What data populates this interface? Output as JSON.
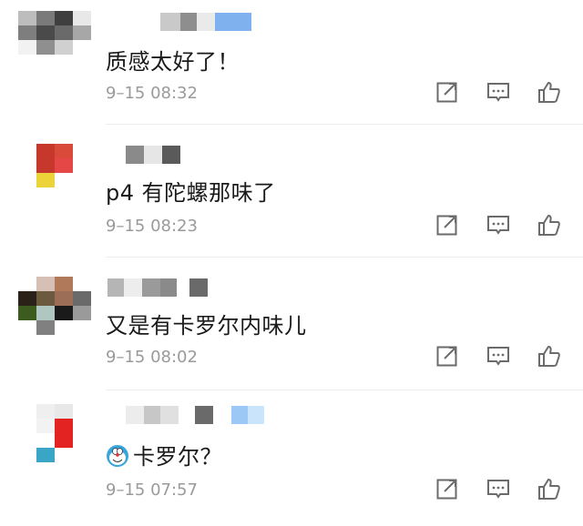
{
  "comments": [
    {
      "text": "质感太好了！",
      "time": "9–15 08:32",
      "avatar": [
        "#bdbdbd",
        "#7a7a7a",
        "#3f3f3f",
        "#e8e8e8",
        "#7e7e7e",
        "#4a4a4a",
        "#6a6a6a",
        "#a7a7a7",
        "#f2f2f2",
        "#8f8f8f",
        "#d0d0d0",
        "#ffffff",
        "#ffffff",
        "#ffffff",
        "#ffffff",
        "#ffffff"
      ],
      "name_blocks": [
        "#c9c9c9",
        "#8e8e8e",
        "#eaeaea",
        "#7fb1ee",
        "#7fb1ee"
      ]
    },
    {
      "text": "p4 有陀螺那味了",
      "time": "9–15 08:23",
      "avatar": [
        "#ffffff",
        "#c6382c",
        "#d94a3a",
        "#ffffff",
        "#ffffff",
        "#c6382c",
        "#e54646",
        "#ffffff",
        "#ffffff",
        "#ecd33a",
        "#ffffff",
        "#ffffff",
        "#ffffff",
        "#ffffff",
        "#ffffff",
        "#ffffff"
      ],
      "name_blocks": [
        "#8a8a8a",
        "#e6e6e6",
        "#5a5a5a"
      ]
    },
    {
      "text": "又是有卡罗尔内味儿",
      "time": "9–15 08:02",
      "avatar": [
        "#ffffff",
        "#d6bfb5",
        "#b07a5a",
        "#ffffff",
        "#2a2118",
        "#6b5a40",
        "#9c6e58",
        "#6a6a6a",
        "#3d5a1f",
        "#b0c6c1",
        "#1a1a1a",
        "#9a9a9a",
        "#ffffff",
        "#808080",
        "#ffffff",
        "#ffffff"
      ],
      "name_blocks": [
        "#b5b5b5",
        "#ededed",
        "#9a9a9a",
        "#8a8a8a",
        "#ffffff",
        "#6a6a6a"
      ]
    },
    {
      "text": "卡罗尔？",
      "time": "9–15 07:57",
      "avatar": [
        "#ffffff",
        "#efefef",
        "#e8e8e8",
        "#ffffff",
        "#ffffff",
        "#f2f2f2",
        "#e32222",
        "#ffffff",
        "#ffffff",
        "#ffffff",
        "#e32222",
        "#ffffff",
        "#ffffff",
        "#3aa6c6",
        "#ffffff",
        "#ffffff"
      ],
      "name_blocks": [
        "#ececec",
        "#c7c7c7",
        "#e0e0e0",
        "#ffffff",
        "#6a6a6a",
        "#ffffff",
        "#9cc8f5",
        "#c9e4fb"
      ]
    }
  ],
  "icons": {
    "share": "share-icon",
    "reply": "comment-icon",
    "like": "thumbs-up-icon",
    "emoji": "doraemon-emoji-icon"
  }
}
